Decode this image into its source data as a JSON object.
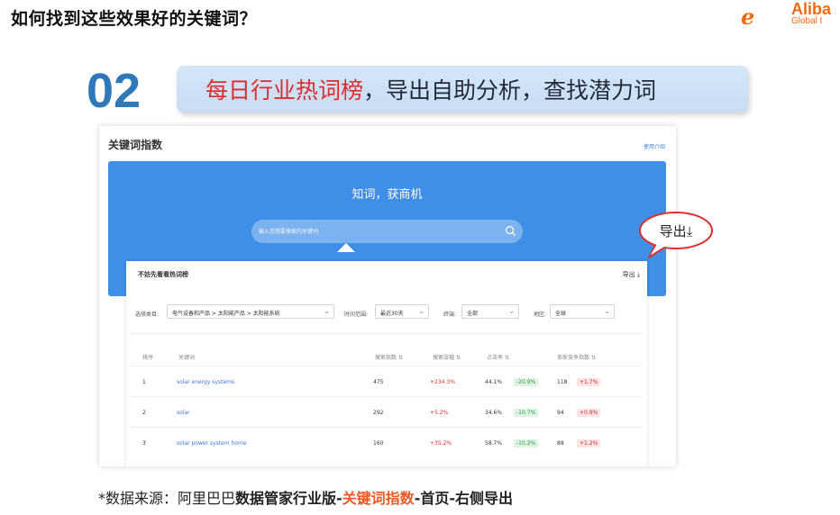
{
  "slide": {
    "title": "如何找到这些效果好的关键词？",
    "step_number": "02",
    "banner": {
      "highlight": "每日行业热词榜",
      "rest": "，导出自助分析，查找潜力词"
    },
    "callout": "导出",
    "footer": {
      "prefix": "*数据来源：阿里巴巴",
      "part1": "数据管家行业版",
      "sep1": "-",
      "part2": "关键词指数",
      "sep2": "-",
      "part3": "首页",
      "sep3": "-",
      "part4": "右侧导出"
    }
  },
  "logo": {
    "mark": "e",
    "main": "Aliba",
    "sub": "Global t"
  },
  "card": {
    "title": "关键词指数",
    "help_link": "使用介绍",
    "hero_title": "知词，获商机",
    "search_placeholder": "输入您想要搜索的关键词",
    "panel": {
      "title": "不妨先看看热词榜",
      "export": "导出",
      "filters": [
        {
          "label": "选择类目:",
          "value": "电气设备和产品 > 太阳能产品 > 太阳能系统"
        },
        {
          "label": "时间范围:",
          "value": "最近30天"
        },
        {
          "label": "终端:",
          "value": "全部"
        },
        {
          "label": "地区:",
          "value": "全球"
        }
      ],
      "columns": [
        "排序",
        "关键词",
        "搜索指数",
        "搜索涨幅",
        "点击率",
        "卖家竞争指数"
      ],
      "rows": [
        {
          "rank": "1",
          "keyword": "solar energy systems",
          "search_index": "475",
          "search_growth": "+234.3%",
          "ctr": "44.1%",
          "ctr_change": "-20.9%",
          "competition": "118",
          "competition_change": "+1.7%"
        },
        {
          "rank": "2",
          "keyword": "solar",
          "search_index": "292",
          "search_growth": "+5.2%",
          "ctr": "34.6%",
          "ctr_change": "-10.7%",
          "competition": "94",
          "competition_change": "+0.8%"
        },
        {
          "rank": "3",
          "keyword": "solar power system home",
          "search_index": "160",
          "search_growth": "+35.2%",
          "ctr": "58.7%",
          "ctr_change": "-10.2%",
          "competition": "88",
          "competition_change": "+1.2%"
        }
      ]
    }
  },
  "icons": {
    "search": "search-icon",
    "export": "download-icon",
    "chevron": "chevron-down-icon",
    "sort": "sort-icon"
  },
  "colors": {
    "title_blue": "#2f79b8",
    "hero_blue": "#3f8ee8",
    "highlight_red": "#e02b2b",
    "footer_orange": "#ef5a23",
    "brand_orange": "#f26a10",
    "link_blue": "#3d7bd9",
    "positive_green": "#2c9c4a"
  }
}
